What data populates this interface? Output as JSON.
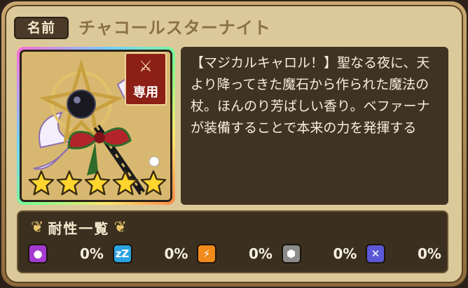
{
  "header": {
    "name_badge": "名前",
    "item_name": "チャコールスターナイト"
  },
  "icon": {
    "exclusive_label": "専用",
    "stars": 5,
    "colors": {
      "frame": "#ff6bd6",
      "star": "#ffd52e"
    }
  },
  "description": "【マジカルキャロル！】聖なる夜に、天より降ってきた魔石から作られた魔法の杖。ほんのり芳ばしい香り。ベファーナが装備することで本来の力を発揮する",
  "resistance": {
    "title": "耐性一覧",
    "items": [
      {
        "icon": "poison-icon",
        "color": "#a43bd0",
        "value": "0%"
      },
      {
        "icon": "sleep-icon",
        "color": "#2aa3e0",
        "value": "0%",
        "glyph": "zZ"
      },
      {
        "icon": "paralysis-icon",
        "color": "#f08a1a",
        "value": "0%",
        "glyph": "⚡"
      },
      {
        "icon": "petrify-icon",
        "color": "#8c8c8c",
        "value": "0%",
        "glyph": "⬢"
      },
      {
        "icon": "curse-icon",
        "color": "#5b58d8",
        "value": "0%",
        "glyph": "✕"
      }
    ]
  }
}
